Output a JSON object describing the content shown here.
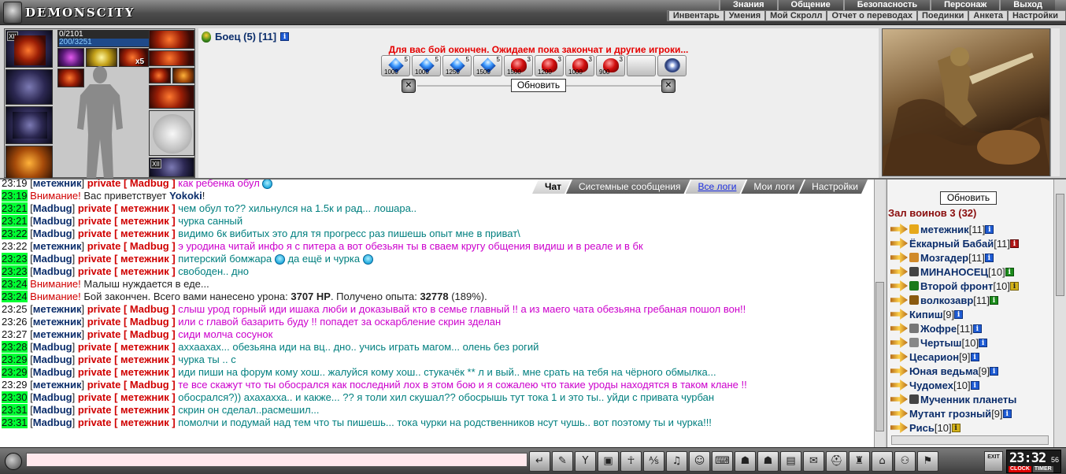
{
  "app": {
    "logo": "DEMONSCITY"
  },
  "menu_top": [
    "Знания",
    "Общение",
    "Безопасность",
    "Персонаж",
    "Выход"
  ],
  "menu_sub": [
    "Инвентарь",
    "Умения",
    "Мой Скролл",
    "Отчет о переводах",
    "Поединки",
    "Анкета",
    "Настройки"
  ],
  "hero": {
    "hp": "0/2101",
    "mp": "200/3251",
    "stack": "x5",
    "slot_badges": [
      "XII",
      "XII"
    ]
  },
  "fighter": {
    "name": "Боец (5) [11]"
  },
  "battle": {
    "message": "Для вас бой окончен. Ожидаем пока закончат и другие игроки...",
    "refresh": "Обновить",
    "potions": [
      {
        "type": "blue",
        "count": "5",
        "value": "1000"
      },
      {
        "type": "blue",
        "count": "5",
        "value": "1000"
      },
      {
        "type": "blue",
        "count": "5",
        "value": "1250"
      },
      {
        "type": "blue",
        "count": "5",
        "value": "1500"
      },
      {
        "type": "red",
        "count": "3",
        "value": "1500"
      },
      {
        "type": "red",
        "count": "3",
        "value": "1200"
      },
      {
        "type": "red",
        "count": "3",
        "value": "1000"
      },
      {
        "type": "red",
        "count": "3",
        "value": "900"
      },
      {
        "type": "empty",
        "count": "",
        "value": ""
      },
      {
        "type": "swirl",
        "count": "",
        "value": ""
      }
    ]
  },
  "chat_tabs": [
    {
      "label": "Чат",
      "state": "active"
    },
    {
      "label": "Системные сообщения",
      "state": "normal"
    },
    {
      "label": "Все логи",
      "state": "logs"
    },
    {
      "label": "Мои логи",
      "state": "normal"
    },
    {
      "label": "Настройки",
      "state": "normal"
    }
  ],
  "chat": [
    {
      "time": "23:19",
      "hl": false,
      "from": "метежник",
      "to": "Madbug",
      "text": "как ребенка обул",
      "color": "pink",
      "smile": true
    },
    {
      "time": "23:19",
      "hl": true,
      "sys": true,
      "parts": [
        [
          "warn",
          "Внимание! "
        ],
        [
          "black",
          "Вас приветствует "
        ],
        [
          "nick",
          "Yokoki"
        ],
        [
          "black",
          "!"
        ]
      ]
    },
    {
      "time": "23:21",
      "hl": true,
      "from": "Madbug",
      "to": "метежник",
      "text": "чем обул то?? хильнулся на 1.5к и рад... лошара..",
      "color": "teal"
    },
    {
      "time": "23:21",
      "hl": true,
      "from": "Madbug",
      "to": "метежник",
      "text": "чурка санный",
      "color": "teal"
    },
    {
      "time": "23:22",
      "hl": true,
      "from": "Madbug",
      "to": "метежник",
      "text": "видимо 6к вибитых это для тя прогресс раз пишешь опыт мне в приват\\",
      "color": "teal"
    },
    {
      "time": "23:22",
      "hl": false,
      "from": "метежник",
      "to": "Madbug",
      "text": "э уродина читай инфо я с питера а вот обезьян ты в сваем кругу общения видиш и в реале и в бк",
      "color": "pink"
    },
    {
      "time": "23:23",
      "hl": true,
      "from": "Madbug",
      "to": "метежник",
      "text": "питерский бомжара",
      "color": "teal",
      "tail": "да ещё и чурка",
      "smile": true,
      "tailSmile": true
    },
    {
      "time": "23:23",
      "hl": true,
      "from": "Madbug",
      "to": "метежник",
      "text": "свободен.. дно",
      "color": "teal"
    },
    {
      "time": "23:24",
      "hl": true,
      "sys": true,
      "parts": [
        [
          "warn",
          "Внимание! "
        ],
        [
          "black",
          "Малыш нуждается в еде..."
        ]
      ]
    },
    {
      "time": "23:24",
      "hl": true,
      "sys": true,
      "parts": [
        [
          "warn",
          "Внимание! "
        ],
        [
          "black",
          "Бой закончен. Всего вами нанесено урона: "
        ],
        [
          "bold",
          "3707 HP"
        ],
        [
          "black",
          ". Получено опыта: "
        ],
        [
          "bold",
          "32778"
        ],
        [
          "black",
          " (189%)."
        ]
      ]
    },
    {
      "time": "23:25",
      "hl": false,
      "from": "метежник",
      "to": "Madbug",
      "text": "слыш урод горный иди ишака люби и доказывай кто в семье главный !! а из маего чата обезьяна гребаная пошол вон!!",
      "color": "pink"
    },
    {
      "time": "23:26",
      "hl": false,
      "from": "метежник",
      "to": "Madbug",
      "text": "или с главой базарить буду !! попадет за оскарбление скрин зделан",
      "color": "pink"
    },
    {
      "time": "23:27",
      "hl": false,
      "from": "метежник",
      "to": "Madbug",
      "text": "сиди молча сосунок",
      "color": "pink"
    },
    {
      "time": "23:28",
      "hl": true,
      "from": "Madbug",
      "to": "метежник",
      "text": "аххаахах... обезьяна иди на вц.. дно.. учись играть магом... олень без рогий",
      "color": "teal"
    },
    {
      "time": "23:29",
      "hl": true,
      "from": "Madbug",
      "to": "метежник",
      "text": "чурка ты .. с",
      "color": "teal"
    },
    {
      "time": "23:29",
      "hl": true,
      "from": "Madbug",
      "to": "метежник",
      "text": "иди пиши на форум кому хош.. жалуйся кому хош.. стукачёк ** л и вый.. мне срать на тебя на чёрного обмылка...",
      "color": "teal"
    },
    {
      "time": "23:29",
      "hl": false,
      "from": "метежник",
      "to": "Madbug",
      "text": "те все скажут что ты обосрался как последний лох в этом бою и я сожалею что такие уроды находятся в таком клане !!",
      "color": "pink"
    },
    {
      "time": "23:30",
      "hl": true,
      "from": "Madbug",
      "to": "метежник",
      "text": "обосрался?)) ахахахха.. и какже... ?? я толи хил скушал?? обосрышь тут тока 1 и это ты.. уйди с привата чурбан",
      "color": "teal"
    },
    {
      "time": "23:31",
      "hl": true,
      "from": "Madbug",
      "to": "метежник",
      "text": "скрин он сделал..расмешил...",
      "color": "teal"
    },
    {
      "time": "23:31",
      "hl": true,
      "from": "Madbug",
      "to": "метежник",
      "text": "помолчи и подумай над тем что ты пишешь... тока чурки на родственников нсут чушь.. вот поэтому ты и чурка!!!",
      "color": "teal"
    }
  ],
  "online": {
    "refresh": "Обновить",
    "title": "Зал воинов 3 (32)",
    "players": [
      {
        "name": "метежник",
        "level": "[11]",
        "info": "b",
        "clan": "#e6a81a"
      },
      {
        "name": "Ёккарный Бабай",
        "level": "[11]",
        "info": "r",
        "clan": ""
      },
      {
        "name": "Мозгадер",
        "level": "[11]",
        "info": "b",
        "clan": "#d08a2a"
      },
      {
        "name": "МИНАНОСЕЦ",
        "level": "[10]",
        "info": "g",
        "clan": "#444"
      },
      {
        "name": "Второй фронт",
        "level": "[10]",
        "info": "y",
        "clan": "#1a7a1a"
      },
      {
        "name": "волкозавр",
        "level": "[11]",
        "info": "g",
        "clan": "#8a5a10"
      },
      {
        "name": "Кипиш",
        "level": "[9]",
        "info": "b",
        "clan": ""
      },
      {
        "name": "Жофре",
        "level": "[11]",
        "info": "b",
        "clan": "#777"
      },
      {
        "name": "Чертыш",
        "level": "[10]",
        "info": "b",
        "clan": "#888"
      },
      {
        "name": "Цесарион",
        "level": "[9]",
        "info": "b",
        "clan": ""
      },
      {
        "name": "Юная ведьма",
        "level": "[9]",
        "info": "b",
        "clan": ""
      },
      {
        "name": "Чудомех",
        "level": "[10]",
        "info": "b",
        "clan": ""
      },
      {
        "name": "Мученник планеты",
        "level": "",
        "info": "",
        "clan": "#444"
      },
      {
        "name": "Мутант грозный",
        "level": "[9]",
        "info": "b",
        "clan": ""
      },
      {
        "name": "Рись",
        "level": "[10]",
        "info": "y",
        "clan": ""
      }
    ]
  },
  "bottom": {
    "input_value": "",
    "tools": [
      "reply-icon",
      "eraser-icon",
      "filter-icon",
      "save-icon",
      "man-icon",
      "translit-icon",
      "sound-icon",
      "smile-icon",
      "keyboard-icon",
      "bag-icon",
      "sack-icon",
      "chest-icon",
      "scroll-icon",
      "helmet-icon",
      "armor-icon",
      "house-icon",
      "group-icon",
      "flag-icon"
    ],
    "tool_glyphs": [
      "↵",
      "✎",
      "Y",
      "▣",
      "☥",
      "⅍",
      "♫",
      "☺",
      "⌨",
      "☗",
      "☗",
      "▤",
      "✉",
      "⛑",
      "♜",
      "⌂",
      "⚇",
      "⚑"
    ],
    "exit": "EXIT",
    "clock_time": "23:32",
    "clock_sec": "56",
    "clock_btn": "CLOCK",
    "timer_btn": "TIMER"
  }
}
